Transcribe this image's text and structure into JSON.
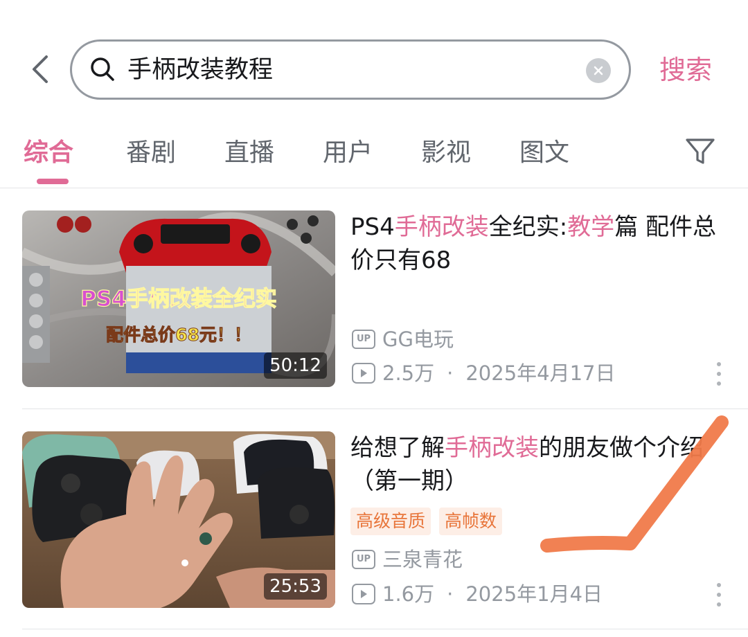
{
  "search": {
    "query": "手柄改装教程",
    "submit_label": "搜索"
  },
  "tabs": [
    {
      "label": "综合",
      "active": true
    },
    {
      "label": "番剧",
      "active": false
    },
    {
      "label": "直播",
      "active": false
    },
    {
      "label": "用户",
      "active": false
    },
    {
      "label": "影视",
      "active": false
    },
    {
      "label": "图文",
      "active": false
    }
  ],
  "results": [
    {
      "title_parts": [
        "PS4",
        "手柄改装",
        "全纪实:",
        "教学",
        "篇 配件总价只有68"
      ],
      "thumb_caption_line1": "PS4手柄改装全纪实",
      "thumb_caption_line2": "配件总价68元！！",
      "duration": "50:12",
      "uploader": "GG电玩",
      "views": "2.5万",
      "date": "2025年4月17日",
      "tags": []
    },
    {
      "title_parts": [
        "给想了解",
        "手柄改装",
        "的朋友做个介绍（第一期）"
      ],
      "duration": "25:53",
      "uploader": "三泉青花",
      "views": "1.6万",
      "date": "2025年1月4日",
      "tags": [
        "高级音质",
        "高帧数"
      ]
    }
  ],
  "labels": {
    "up_badge": "UP",
    "dot": "·"
  },
  "colors": {
    "accent": "#e06b96",
    "tag_text": "#e8753a",
    "tag_bg": "#fdeee6",
    "annotation": "#f07a4a"
  },
  "icons": [
    "back-arrow-icon",
    "search-icon",
    "clear-icon",
    "filter-icon",
    "up-icon",
    "play-icon",
    "more-icon"
  ]
}
